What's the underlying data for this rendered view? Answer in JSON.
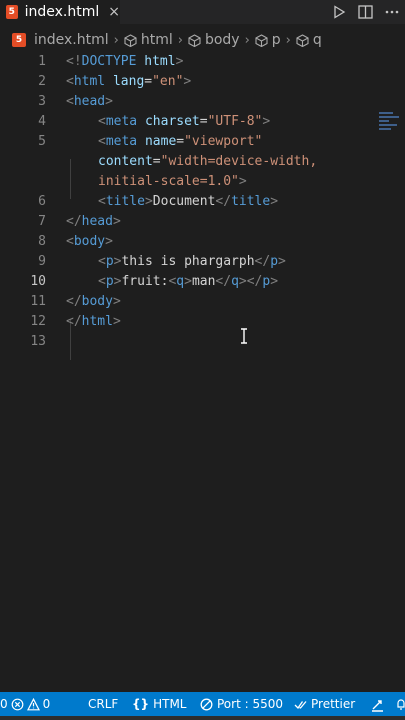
{
  "tab": {
    "filename": "index.html",
    "badge": "5",
    "close": "×"
  },
  "breadcrumb": {
    "file": "index.html",
    "items": [
      "html",
      "body",
      "p",
      "q"
    ]
  },
  "editor": {
    "line_numbers": [
      "1",
      "2",
      "3",
      "4",
      "5",
      "",
      "",
      "6",
      "7",
      "8",
      "9",
      "10",
      "11",
      "12",
      "13"
    ],
    "active_line": "10",
    "lines": {
      "l1_punct1": "<!",
      "l1_tag": "DOCTYPE",
      "l1_attr": " html",
      "l1_punct2": ">",
      "l2_open": "<",
      "l2_tag": "html",
      "l2_attr": " lang",
      "l2_eq": "=",
      "l2_str": "\"en\"",
      "l2_close": ">",
      "l3_open": "<",
      "l3_tag": "head",
      "l3_close": ">",
      "l4_open": "<",
      "l4_tag": "meta",
      "l4_attr": " charset",
      "l4_eq": "=",
      "l4_str": "\"UTF-8\"",
      "l4_close": ">",
      "l5_open": "<",
      "l5_tag": "meta",
      "l5_attr": " name",
      "l5_eq": "=",
      "l5_str": "\"viewport\"",
      "l5b_attr": "content",
      "l5b_eq": "=",
      "l5b_str": "\"width=device-width,",
      "l5c_str": "initial-scale=1.0\"",
      "l5c_close": ">",
      "l6_open": "<",
      "l6_tag": "title",
      "l6_close": ">",
      "l6_text": "Document",
      "l6_end_open": "</",
      "l6_end_tag": "title",
      "l6_end_close": ">",
      "l7_open": "</",
      "l7_tag": "head",
      "l7_close": ">",
      "l8_open": "<",
      "l8_tag": "body",
      "l8_close": ">",
      "l9_open": "<",
      "l9_tag": "p",
      "l9_close": ">",
      "l9_text": "this is phargarph",
      "l9_end_open": "</",
      "l9_end_tag": "p",
      "l9_end_close": ">",
      "l10_open": "<",
      "l10_tag": "p",
      "l10_close": ">",
      "l10_text": "fruit:",
      "l10_q_open": "<",
      "l10_q_tag": "q",
      "l10_q_close": ">",
      "l10_q_text": "man",
      "l10_qe_open": "</",
      "l10_qe_tag": "q",
      "l10_qe_close": ">",
      "l10_pe_open": "</",
      "l10_pe_tag": "p",
      "l10_pe_close": ">",
      "l11_open": "</",
      "l11_tag": "body",
      "l11_close": ">",
      "l12_open": "</",
      "l12_tag": "html",
      "l12_close": ">"
    }
  },
  "statusbar": {
    "problems_errors": "0",
    "problems_warnings": "0",
    "eol": "CRLF",
    "language": "HTML",
    "port": "Port : 5500",
    "prettier": "Prettier"
  },
  "colors": {
    "accent": "#007acc",
    "tag": "#569cd6",
    "attr": "#9cdcfe",
    "string": "#ce9178"
  }
}
